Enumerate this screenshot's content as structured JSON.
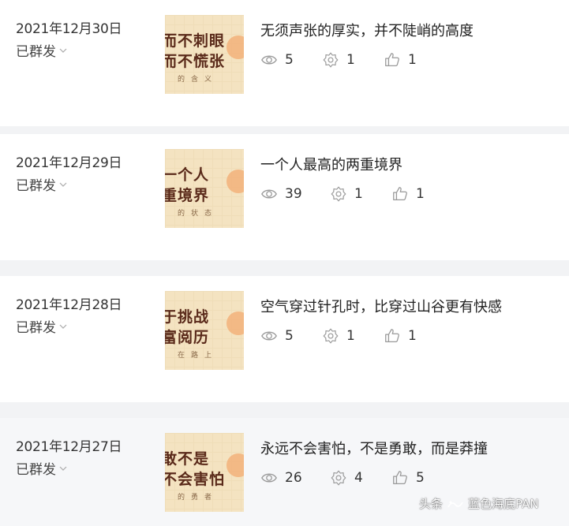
{
  "posts": [
    {
      "date": "2021年12月30日",
      "status": "已群发",
      "title": "无须声张的厚实，并不陡峭的高度",
      "views": "5",
      "shares": "1",
      "likes": "1",
      "thumb": {
        "line1": "而不刺眼",
        "line2": "而不慌张",
        "line3": "的含义"
      }
    },
    {
      "date": "2021年12月29日",
      "status": "已群发",
      "title": "一个人最高的两重境界",
      "views": "39",
      "shares": "1",
      "likes": "1",
      "thumb": {
        "line1": "一个人",
        "line2": "重境界",
        "line3": "的状态"
      }
    },
    {
      "date": "2021年12月28日",
      "status": "已群发",
      "title": "空气穿过针孔时，比穿过山谷更有快感",
      "views": "5",
      "shares": "1",
      "likes": "1",
      "thumb": {
        "line1": "于挑战",
        "line2": "富阅历",
        "line3": "在路上"
      }
    },
    {
      "date": "2021年12月27日",
      "status": "已群发",
      "title": "永远不会害怕，不是勇敢，而是莽撞",
      "views": "26",
      "shares": "4",
      "likes": "5",
      "thumb": {
        "line1": "敢不是",
        "line2": "不会害怕",
        "line3": "的勇者"
      }
    }
  ],
  "watermark": {
    "prefix": "头条",
    "handle": "蓝色海底PAN"
  },
  "icons": {
    "views": "eye-icon",
    "shares": "share-gear-icon",
    "likes": "thumbs-up-icon",
    "status": "chevron-down-icon"
  }
}
